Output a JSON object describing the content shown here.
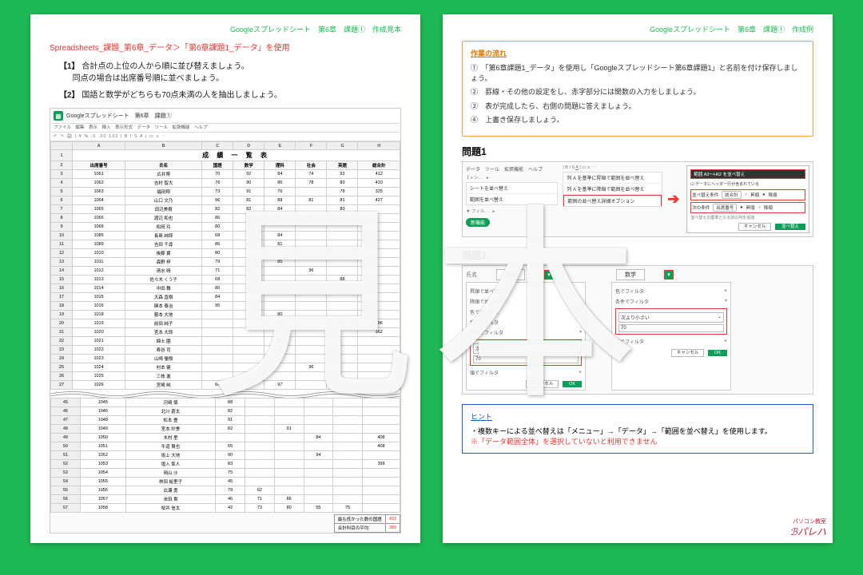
{
  "header_left": "Googleスプレッドシート　第6章　課題①　作成見本",
  "header_right": "Googleスプレッドシート　第6章　課題①　作成例",
  "subtitle": "Spreadsheets_課題_第6章_データ＞「第6章課題1_データ」を使用",
  "instr1_num": "【1】",
  "instr1_a": "合計点の上位の人から順に並び替えましょう。",
  "instr1_b": "同点の場合は出席番号順に並べましょう。",
  "instr2_num": "【2】",
  "instr2": "国語と数学がどちらも70点未満の人を抽出しましょう。",
  "sheet": {
    "title": "Googleスプレッドシート　第6章　課題①",
    "menus": "ファイル　編集　表示　挿入　表示形式　データ　ツール　拡張機能　ヘルプ",
    "toolbar": "↶ ↷  🖨  |  ¥  %  .0  .00  123  |  B  I  S  A  |  ▭  ≡  ⋯",
    "grid_title": "成 績 一 覧 表",
    "columns": [
      "出席番号",
      "氏名",
      "国語",
      "数学",
      "理科",
      "社会",
      "英語",
      "総合計"
    ],
    "rows_top": [
      [
        "1061",
        "広井博",
        "70",
        "92",
        "84",
        "74",
        "92",
        "412"
      ],
      [
        "1062",
        "吉村 智大",
        "76",
        "90",
        "86",
        "78",
        "80",
        "410"
      ],
      [
        "1063",
        "福田翔",
        "73",
        "91",
        "76",
        "—",
        "78",
        "325"
      ],
      [
        "1064",
        "山口 文乃",
        "96",
        "81",
        "88",
        "81",
        "81",
        "427"
      ],
      [
        "1065",
        "田辺美樹",
        "82",
        "82",
        "84",
        "—",
        "80",
        "—"
      ],
      [
        "1066",
        "渡辺 和也",
        "86",
        "78",
        "81",
        "92",
        "—",
        "—"
      ],
      [
        "1068",
        "松岡 玲",
        "80",
        "70",
        "—",
        "—",
        "—",
        "—"
      ],
      [
        "1085",
        "長島 純郎",
        "68",
        "—",
        "84",
        "—",
        "—",
        "—"
      ],
      [
        "1089",
        "吉田 千尋",
        "86",
        "73",
        "81",
        "—",
        "—",
        "—"
      ],
      [
        "1010",
        "後藤 翼",
        "80",
        "—",
        "—",
        "—",
        "—",
        "—"
      ],
      [
        "1011",
        "森野 梓",
        "79",
        "72",
        "85",
        "—",
        "—",
        "—"
      ],
      [
        "1012",
        "清水 晴",
        "71",
        "80",
        "—",
        "96",
        "—",
        "—"
      ],
      [
        "1013",
        "佐々木 くう子",
        "68",
        "71",
        "—",
        "—",
        "88",
        "—"
      ],
      [
        "1014",
        "中田 舞",
        "80",
        "72",
        "—",
        "—",
        "—",
        "—"
      ],
      [
        "1015",
        "大森 直樹",
        "84",
        "—",
        "—",
        "—",
        "—",
        "—"
      ],
      [
        "1016",
        "関本 泰治",
        "95",
        "—",
        "—",
        "—",
        "—",
        "—"
      ],
      [
        "1018",
        "藤本 大地",
        "",
        "—",
        "80",
        "—",
        "—",
        "—"
      ],
      [
        "1019",
        "前田 純子",
        "",
        "—",
        "81",
        "—",
        "94",
        "396"
      ],
      [
        "1020",
        "宮本 大郎",
        "",
        "—",
        "—",
        "—",
        "—",
        "362"
      ],
      [
        "1021",
        "綿士 園",
        "",
        "—",
        "81",
        "—",
        "—",
        "—"
      ],
      [
        "1022",
        "寿谷 司",
        "",
        "—",
        "51",
        "—",
        "—",
        "—"
      ],
      [
        "1023",
        "山崎 優樹",
        "",
        "—",
        "—",
        "—",
        "—",
        "—"
      ],
      [
        "1024",
        "村本 健",
        "",
        "—",
        "—",
        "96",
        "—",
        "—"
      ],
      [
        "1025",
        "三枝 進",
        "",
        "—",
        "—",
        "—",
        "—",
        "—"
      ],
      [
        "1026",
        "宮崎 純",
        "66",
        "—",
        "97",
        "—",
        "—",
        "—"
      ]
    ],
    "rows_bottom": [
      [
        "1045",
        "河崎 慎",
        "88",
        "—",
        "—",
        "—",
        "—",
        "—"
      ],
      [
        "1046",
        "北川 蒼太",
        "82",
        "—",
        "—",
        "—",
        "—",
        "—"
      ],
      [
        "1048",
        "松本 豊",
        "91",
        "—",
        "—",
        "—",
        "—",
        "—"
      ],
      [
        "1049",
        "宮本 紗季",
        "82",
        "—",
        "91",
        "—",
        "—",
        "—"
      ],
      [
        "1050",
        "木村 里",
        "",
        "—",
        "—",
        "84",
        "—",
        "408"
      ],
      [
        "1051",
        "牛道 賢也",
        "65",
        "—",
        "—",
        "—",
        "—",
        "408"
      ],
      [
        "1052",
        "坂上 大地",
        "90",
        "—",
        "—",
        "94",
        "—",
        "—"
      ],
      [
        "1053",
        "塩入 隼人",
        "83",
        "—",
        "—",
        "—",
        "—",
        "399"
      ],
      [
        "1054",
        "岡山 沙",
        "75",
        "—",
        "—",
        "—",
        "—",
        "—"
      ],
      [
        "1055",
        "林田 絵里子",
        "45",
        "—",
        "—",
        "—",
        "—",
        "—"
      ],
      [
        "1056",
        "広瀬 勇",
        "79",
        "62",
        "—",
        "—",
        "—",
        "—"
      ],
      [
        "1057",
        "米田 貴",
        "46",
        "71",
        "86",
        "—",
        "—",
        "—"
      ],
      [
        "1058",
        "桜井 信太",
        "42",
        "73",
        "80",
        "55",
        "75",
        "—"
      ]
    ],
    "summary": [
      [
        "最も低かった数の国語",
        "433"
      ],
      [
        "合計科目の平均",
        "389"
      ]
    ]
  },
  "flow": {
    "title": "作業の流れ",
    "items": [
      "①　「第6章課題1_データ」を使用し「Googleスプレッドシート第6章課題1」と名前を付け保存しましょう。",
      "②　罫線・その他の設定をし、赤字部分には関数の入力をしましょう。",
      "③　表が完成したら、右側の問題に答えましょう。",
      "④　上書き保存しましょう。"
    ]
  },
  "q1": {
    "title": "問題1",
    "tab": "データ　ツール　拡張機能　ヘルプ",
    "menu_items": [
      "シートを並べ替え",
      "範囲を並べ替え",
      "フィルタを作成"
    ],
    "sub_items": [
      "列 A を基準に昇順で範囲を並べ替え",
      "列 A を基準に降順で範囲を並べ替え",
      "範囲の並べ替え詳細オプション"
    ],
    "pill": "新機能",
    "sort_title": "範囲 A3〜H62 を並べ替え",
    "sort_check": "データにヘッダー行が含まれている",
    "sort_row1_label": "並べ替え条件",
    "sort_row1_col": "総合計",
    "sort_row2_label": "次の条件",
    "sort_row2_col": "出席番号",
    "asc": "昇順",
    "desc": "降順",
    "add_rule": "並べ替えの基準となる別の列を追加",
    "cancel": "キャンセル",
    "ok": "並べ替え"
  },
  "q2": {
    "title": "問題2",
    "col_a": "国語",
    "col_b": "数学",
    "sec_sort1": "昇順で並べ替え",
    "sec_sort2": "降順で並べ替え",
    "sec_color": "色で並べ替え",
    "sec_colorf": "色でフィルタ",
    "sec_cond": "条件でフィルタ",
    "sec_cond2": "条件でフィルタ",
    "cond_label": "次より小さい",
    "cond_val": "70",
    "sec_valf": "値でフィルタ",
    "cancel": "キャンセル",
    "ok": "OK"
  },
  "hint": {
    "title": "ヒント",
    "line1": "・複数キーによる並べ替えは「メニュー」→「データ」→「範囲を並べ替え」を使用します。",
    "line2": "※「データ範囲全体」を選択していないと利用できません"
  },
  "brand_jp": "パソコン教室",
  "brand": "パレハ",
  "watermark": "見本"
}
